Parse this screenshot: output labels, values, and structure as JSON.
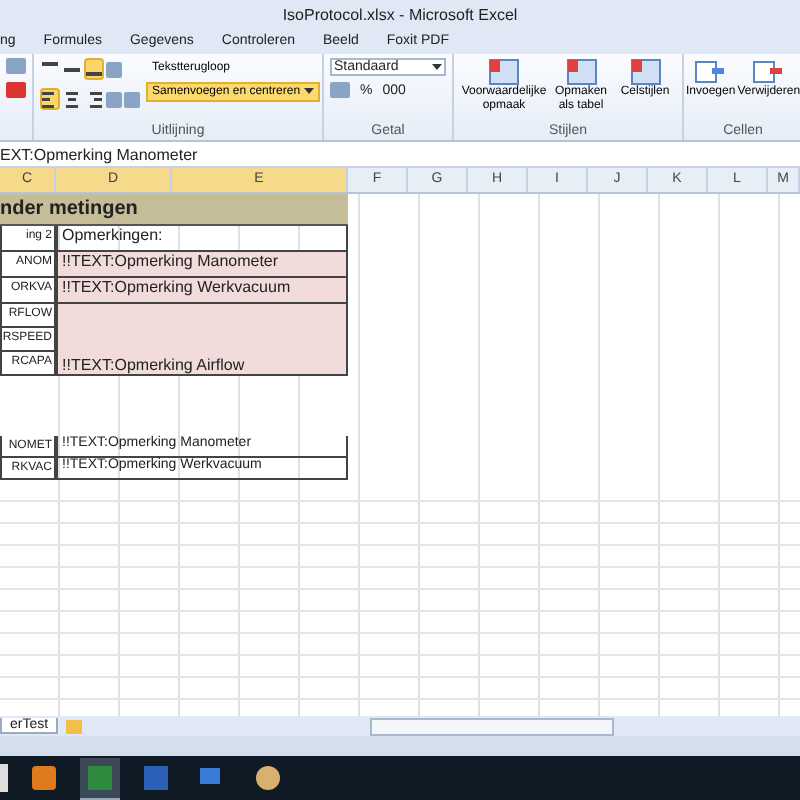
{
  "window": {
    "title": "IsoProtocol.xlsx - Microsoft Excel"
  },
  "menu_tabs": [
    "ng",
    "Formules",
    "Gegevens",
    "Controleren",
    "Beeld",
    "Foxit PDF"
  ],
  "ribbon": {
    "alignment": {
      "top_row": [
        {
          "kind": "top",
          "selected": false
        },
        {
          "kind": "middle",
          "selected": false
        },
        {
          "kind": "bottom",
          "selected": true
        }
      ],
      "bottom_row": [
        {
          "kind": "left",
          "selected": true
        },
        {
          "kind": "center",
          "selected": false
        },
        {
          "kind": "right",
          "selected": false
        }
      ],
      "wrap_button": "Tekstterugloop",
      "merge_button": "Samenvoegen en centreren",
      "merge_selected": true,
      "label": "Uitlijning"
    },
    "number": {
      "format": "Standaard",
      "percent": "%",
      "thousands": "000",
      "label": "Getal"
    },
    "styles": {
      "buttons": [
        "Voorwaardelijke opmaak",
        "Opmaken als tabel",
        "Celstijlen"
      ],
      "label": "Stijlen"
    },
    "cells": {
      "buttons": [
        "Invoegen",
        "Verwijderen"
      ],
      "label": "Cellen"
    }
  },
  "formula_bar": {
    "value": "EXT:Opmerking Manometer"
  },
  "columns": [
    "C",
    "D",
    "E",
    "F",
    "G",
    "H",
    "I",
    "J",
    "K",
    "L",
    "M"
  ],
  "rows": [
    {
      "kind": "title",
      "text": "nder metingen"
    },
    {
      "kind": "plain",
      "c": "ing 2",
      "d": "Opmerkingen:"
    },
    {
      "kind": "remark",
      "c": "ANOM",
      "d": "!!TEXT:Opmerking Manometer"
    },
    {
      "kind": "remark",
      "c": "ORKVA",
      "d": "!!TEXT:Opmerking Werkvacuum"
    },
    {
      "kind": "block",
      "c": [
        "RFLOW",
        "RSPEED",
        "RCAPA"
      ],
      "d": "!!TEXT:Opmerking Airflow"
    },
    {
      "kind": "blank"
    },
    {
      "kind": "blank"
    },
    {
      "kind": "blank"
    },
    {
      "kind": "boxed",
      "c": "NOMET",
      "d": "!!TEXT:Opmerking Manometer"
    },
    {
      "kind": "boxed",
      "c": "RKVAC",
      "d": "!!TEXT:Opmerking Werkvacuum"
    }
  ],
  "sheet_tab": "erTest",
  "taskbar": [
    {
      "kind": "media",
      "selected": false
    },
    {
      "kind": "excel",
      "selected": true
    },
    {
      "kind": "word",
      "selected": false
    },
    {
      "kind": "network",
      "selected": false
    },
    {
      "kind": "paint",
      "selected": false
    }
  ]
}
